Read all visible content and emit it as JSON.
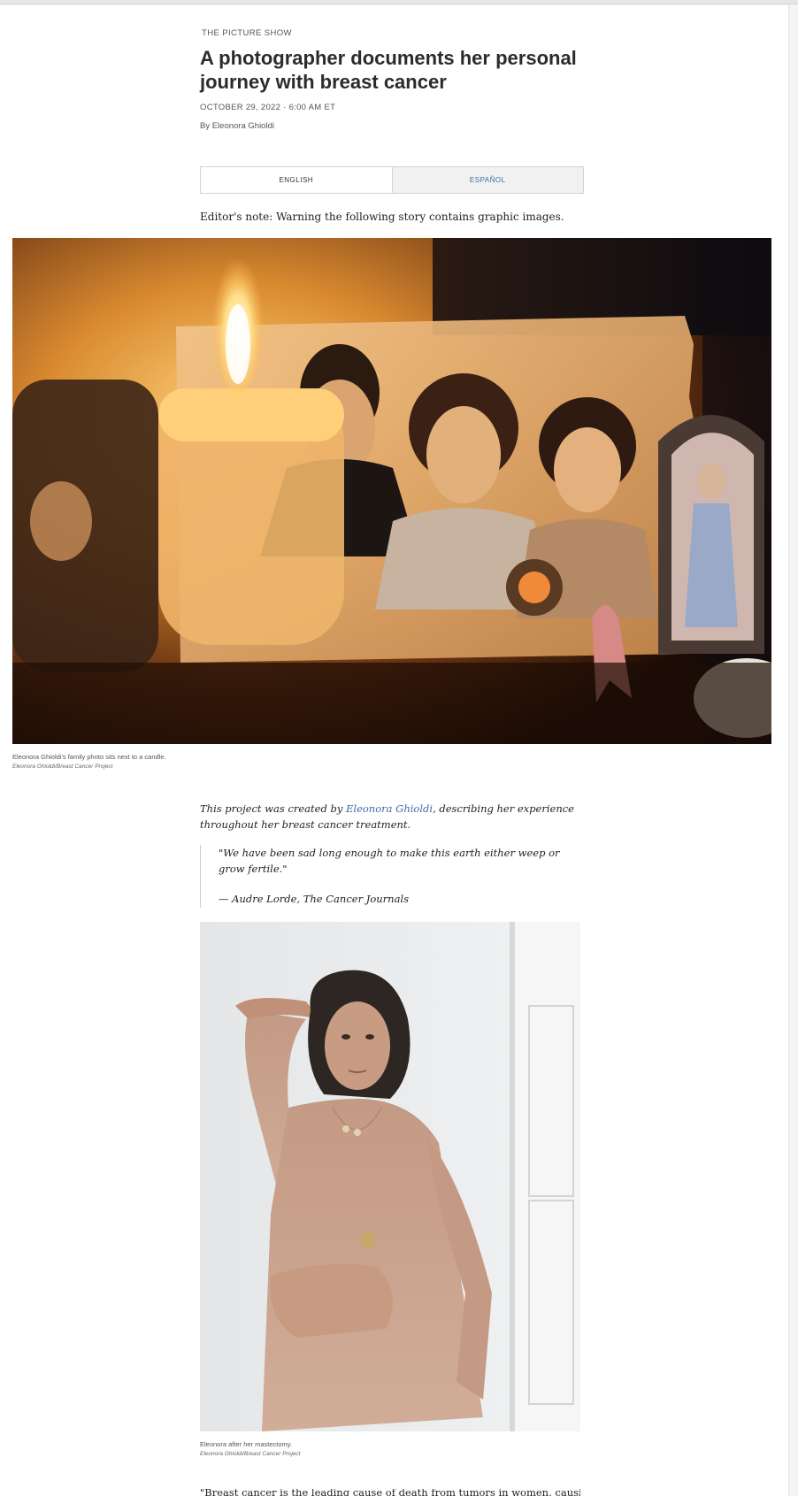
{
  "article": {
    "kicker": "THE PICTURE SHOW",
    "headline": "A photographer documents her personal journey with breast cancer",
    "date": "OCTOBER 29, 2022 · 6:00 AM ET",
    "byline": "By Eleonora Ghioldi"
  },
  "language_tabs": {
    "english": "ENGLISH",
    "espanol": "ESPAÑOL",
    "active": "ENGLISH"
  },
  "editor_note": "Editor's note: Warning the following story contains graphic images.",
  "hero_image": {
    "caption": "Eleonora Ghioldi's family photo sits next to a candle.",
    "credit": "Eleonora Ghioldi/Breast Cancer Project"
  },
  "intro": {
    "before_link": "This project was created by ",
    "link_text": "Eleonora Ghioldi",
    "after_link": ", describing her experience throughout her breast cancer treatment."
  },
  "quote": {
    "text": "\"We have been sad long enough to make this earth either weep or grow fertile.\"",
    "attribution": "— Audre Lorde, The Cancer Journals"
  },
  "portrait_image": {
    "caption": "Eleonora after her mastectomy.",
    "credit": "Eleonora Ghioldi/Breast Cancer Project"
  },
  "next_paragraph_start": "\"Breast cancer is the leading cause of death from tumors in women, causing",
  "colors": {
    "link": "#3f6aa8",
    "text": "#2a2a2a",
    "muted": "#555555"
  }
}
